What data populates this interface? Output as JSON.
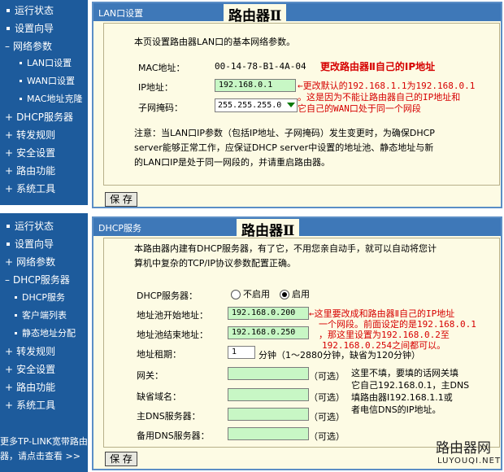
{
  "top_sidebar": {
    "items": [
      {
        "label": "运行状态"
      },
      {
        "label": "设置向导"
      },
      {
        "label": "网络参数"
      },
      {
        "label": "LAN口设置"
      },
      {
        "label": "WAN口设置"
      },
      {
        "label": "MAC地址克隆"
      },
      {
        "label": "DHCP服务器"
      },
      {
        "label": "转发规则"
      },
      {
        "label": "安全设置"
      },
      {
        "label": "路由功能"
      },
      {
        "label": "系统工具"
      }
    ]
  },
  "bottom_sidebar": {
    "items": [
      {
        "label": "运行状态"
      },
      {
        "label": "设置向导"
      },
      {
        "label": "网络参数"
      },
      {
        "label": "DHCP服务器"
      },
      {
        "label": "DHCP服务"
      },
      {
        "label": "客户端列表"
      },
      {
        "label": "静态地址分配"
      },
      {
        "label": "转发规则"
      },
      {
        "label": "安全设置"
      },
      {
        "label": "路由功能"
      },
      {
        "label": "系统工具"
      }
    ],
    "promo_line1": "更多TP-LINK宽带路由",
    "promo_line2": "器，请点击查看 >>"
  },
  "lan_panel": {
    "title": "LAN口设置",
    "big_title": "路由器Ⅱ",
    "intro": "本页设置路由器LAN口的基本网络参数。",
    "mac_label": "MAC地址：",
    "mac_value": "00-14-78-B1-4A-04",
    "ip_label": "IP地址：",
    "ip_value": "192.168.0.1",
    "mask_label": "子网掩码：",
    "mask_value": "255.255.255.0",
    "annotation_title": "更改路由器Ⅱ自己的IP地址",
    "annotation_l1": "←更改默认的192.168.1.1为192.168.0.1",
    "annotation_l2": "。这是因为不能让路由器自己的IP地址和",
    "annotation_l3": "它自己的WAN口处于同一个网段",
    "note_l1": "注意：当LAN口IP参数（包括IP地址、子网掩码）发生变更时，为确保DHCP",
    "note_l2": "server能够正常工作，应保证DHCP server中设置的地址池、静态地址与新",
    "note_l3": "的LAN口IP是处于同一网段的，并请重启路由器。",
    "save_label": "保 存"
  },
  "dhcp_panel": {
    "title": "DHCP服务",
    "big_title": "路由器Ⅱ",
    "intro_l1": "本路由器内建有DHCP服务器，有了它，不用您亲自动手，就可以自动将您计",
    "intro_l2": "算机中复杂的TCP/IP协议参数配置正确。",
    "dhcp_server_label": "DHCP服务器：",
    "opt_off": "不启用",
    "opt_on": "启用",
    "start_label": "地址池开始地址：",
    "start_value": "192.168.0.200",
    "end_label": "地址池结束地址：",
    "end_value": "192.168.0.250",
    "lease_label": "地址租期：",
    "lease_value": "1",
    "lease_unit": "分钟（1～2880分钟，缺省为120分钟）",
    "gateway_label": "网关：",
    "domain_label": "缺省域名：",
    "dns1_label": "主DNS服务器：",
    "dns2_label": "备用DNS服务器：",
    "optional": "（可选）",
    "anno_l1": "←这里要改成和路由器Ⅱ自己的IP地址",
    "anno_l2": "一个网段。前面设定的是192.168.0.1",
    "anno_l3": "，那这里设置为192.168.0.2至",
    "anno_l4": "192.168.0.254之间都可以。",
    "black_l1": "这里不填，要填的话网关填",
    "black_l2": "它自己192.168.0.1，主DNS",
    "black_l3": "填路由器Ⅰ192.168.1.1或",
    "black_l4": "者电信DNS的IP地址。",
    "save_label": "保 存"
  },
  "watermark": {
    "line1": "路由器网",
    "line2": "LUYOUQI.NET"
  },
  "colors": {
    "sidebar": "#1d5b9c",
    "panel_bg": "#fdfbe4",
    "header": "#3e78b8",
    "annotation": "#d60000",
    "field_green": "#c8f7c5"
  }
}
